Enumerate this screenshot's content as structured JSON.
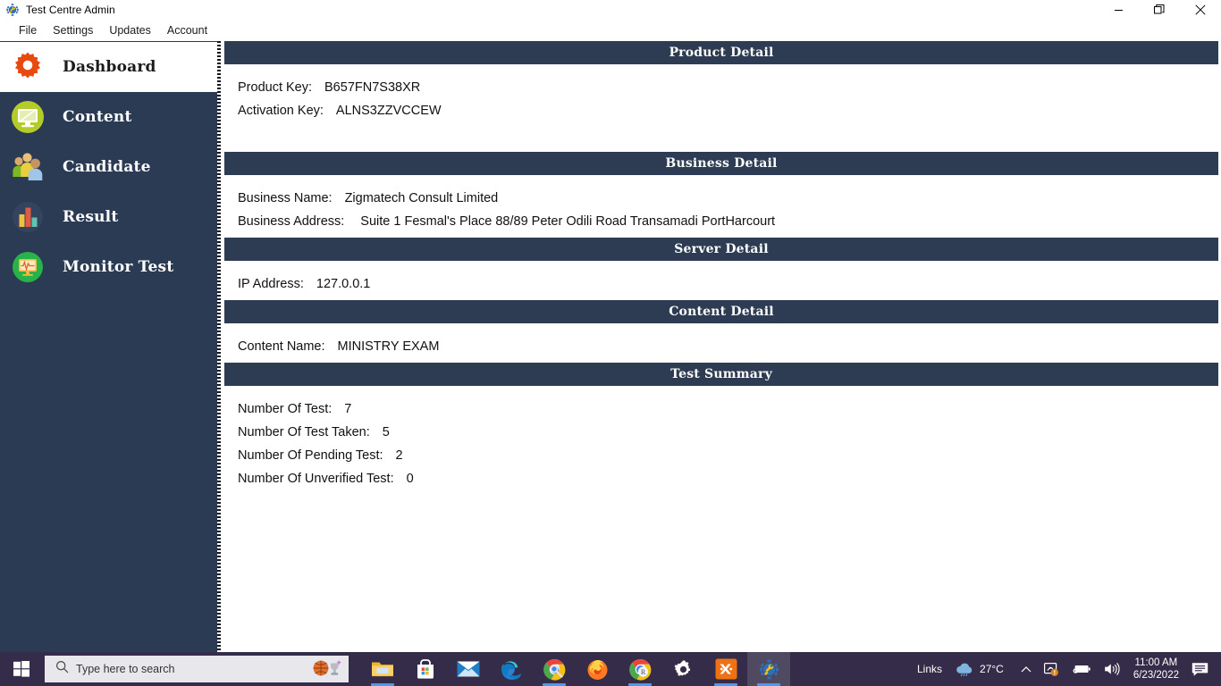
{
  "window": {
    "title": "Test Centre Admin",
    "icon": "gear-wrench-icon",
    "minimize_label": "Minimize",
    "maximize_label": "Restore",
    "close_label": "Close"
  },
  "menubar": {
    "items": [
      {
        "label": "File"
      },
      {
        "label": "Settings"
      },
      {
        "label": "Updates"
      },
      {
        "label": "Account"
      }
    ]
  },
  "sidebar": {
    "items": [
      {
        "label": "Dashboard",
        "icon": "gear-icon",
        "active": true
      },
      {
        "label": "Content",
        "icon": "monitor-icon",
        "active": false
      },
      {
        "label": "Candidate",
        "icon": "users-icon",
        "active": false
      },
      {
        "label": "Result",
        "icon": "bar-chart-icon",
        "active": false
      },
      {
        "label": "Monitor Test",
        "icon": "pulse-icon",
        "active": false
      }
    ]
  },
  "main": {
    "sections": [
      {
        "title": "Product Detail",
        "fields": [
          {
            "label": "Product Key:",
            "value": "B657FN7S38XR"
          },
          {
            "label": "Activation Key:",
            "value": "ALNS3ZZVCCEW"
          }
        ]
      },
      {
        "title": "Business Detail",
        "fields": [
          {
            "label": "Business Name:",
            "value": "Zigmatech Consult Limited"
          },
          {
            "label": "Business Address:",
            "value": "Suite 1 Fesmal's Place 88/89 Peter Odili Road Transamadi PortHarcourt"
          }
        ]
      },
      {
        "title": "Server Detail",
        "fields": [
          {
            "label": "IP Address:",
            "value": "127.0.0.1"
          }
        ]
      },
      {
        "title": "Content Detail",
        "fields": [
          {
            "label": "Content Name:",
            "value": "MINISTRY EXAM"
          }
        ]
      },
      {
        "title": "Test Summary",
        "fields": [
          {
            "label": "Number Of Test:",
            "value": "7"
          },
          {
            "label": "Number Of Test Taken:",
            "value": "5"
          },
          {
            "label": "Number Of Pending Test:",
            "value": "2"
          },
          {
            "label": "Number Of Unverified Test:",
            "value": "0"
          }
        ]
      }
    ]
  },
  "taskbar": {
    "start_label": "Start",
    "search": {
      "placeholder": "Type here to search",
      "icon": "search-icon",
      "decoration": "basketball-and-trophy-icon"
    },
    "apps": [
      {
        "name": "file-explorer-icon",
        "label": "File Explorer",
        "active": false,
        "running": true
      },
      {
        "name": "microsoft-store-icon",
        "label": "Microsoft Store",
        "active": false,
        "running": false
      },
      {
        "name": "mail-icon",
        "label": "Mail",
        "active": false,
        "running": false
      },
      {
        "name": "edge-icon",
        "label": "Microsoft Edge",
        "active": false,
        "running": false
      },
      {
        "name": "chrome-icon",
        "label": "Google Chrome",
        "active": false,
        "running": true
      },
      {
        "name": "firefox-icon",
        "label": "Mozilla Firefox",
        "active": false,
        "running": false
      },
      {
        "name": "chrome-r-icon",
        "label": "Chrome",
        "active": false,
        "running": true
      },
      {
        "name": "settings-gear-icon",
        "label": "Settings",
        "active": false,
        "running": false
      },
      {
        "name": "xampp-icon",
        "label": "XAMPP",
        "active": false,
        "running": true
      },
      {
        "name": "test-centre-admin-icon",
        "label": "Test Centre Admin",
        "active": true,
        "running": true
      }
    ],
    "tray": {
      "links_label": "Links",
      "weather_icon": "cloud-icon",
      "temperature": "27°C",
      "chevron_icon": "chevron-up-icon",
      "network_icon": "network-share-icon",
      "battery_icon": "battery-icon",
      "volume_icon": "volume-icon",
      "time": "11:00 AM",
      "date": "6/23/2022",
      "notifications_icon": "notification-icon"
    }
  },
  "colors": {
    "sidebar_bg": "#2b3b54",
    "section_header_bg": "#2d3c52",
    "taskbar_bg": "#342c49",
    "accent_orange": "#e8490f",
    "content_green": "#b4cc29",
    "monitor_green": "#27b24a"
  }
}
